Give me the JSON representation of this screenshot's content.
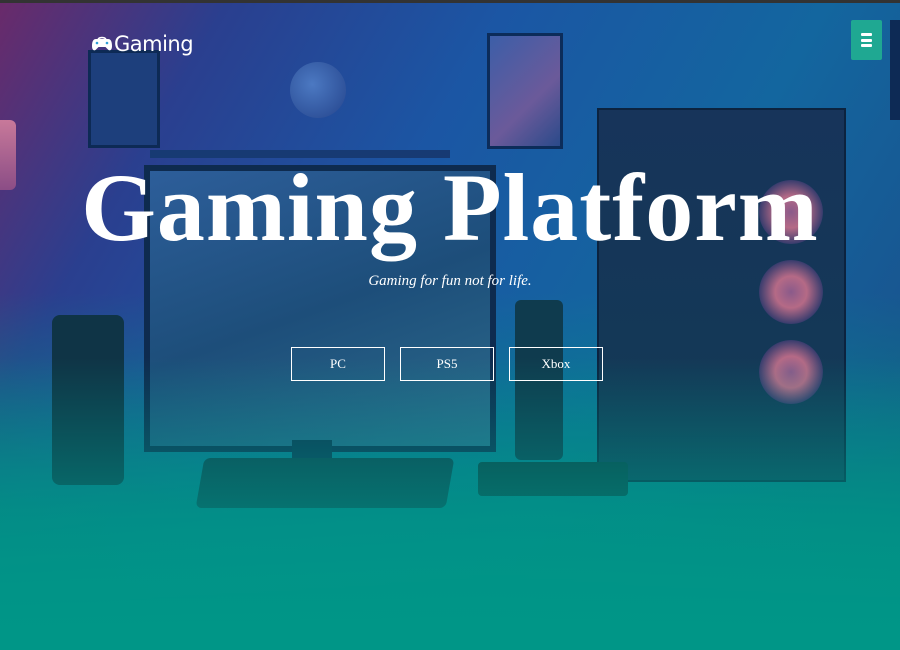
{
  "header": {
    "logo_text": "Gaming",
    "logo_icon": "gamepad-icon",
    "menu_icon": "hamburger-menu-icon"
  },
  "hero": {
    "title": "Gaming Platform",
    "subtitle": "Gaming for fun not for life.",
    "buttons": [
      {
        "label": "PC"
      },
      {
        "label": "PS5"
      },
      {
        "label": "Xbox"
      }
    ]
  },
  "colors": {
    "accent": "#1fa892",
    "bottom_gradient": "#009687",
    "text": "#ffffff"
  }
}
